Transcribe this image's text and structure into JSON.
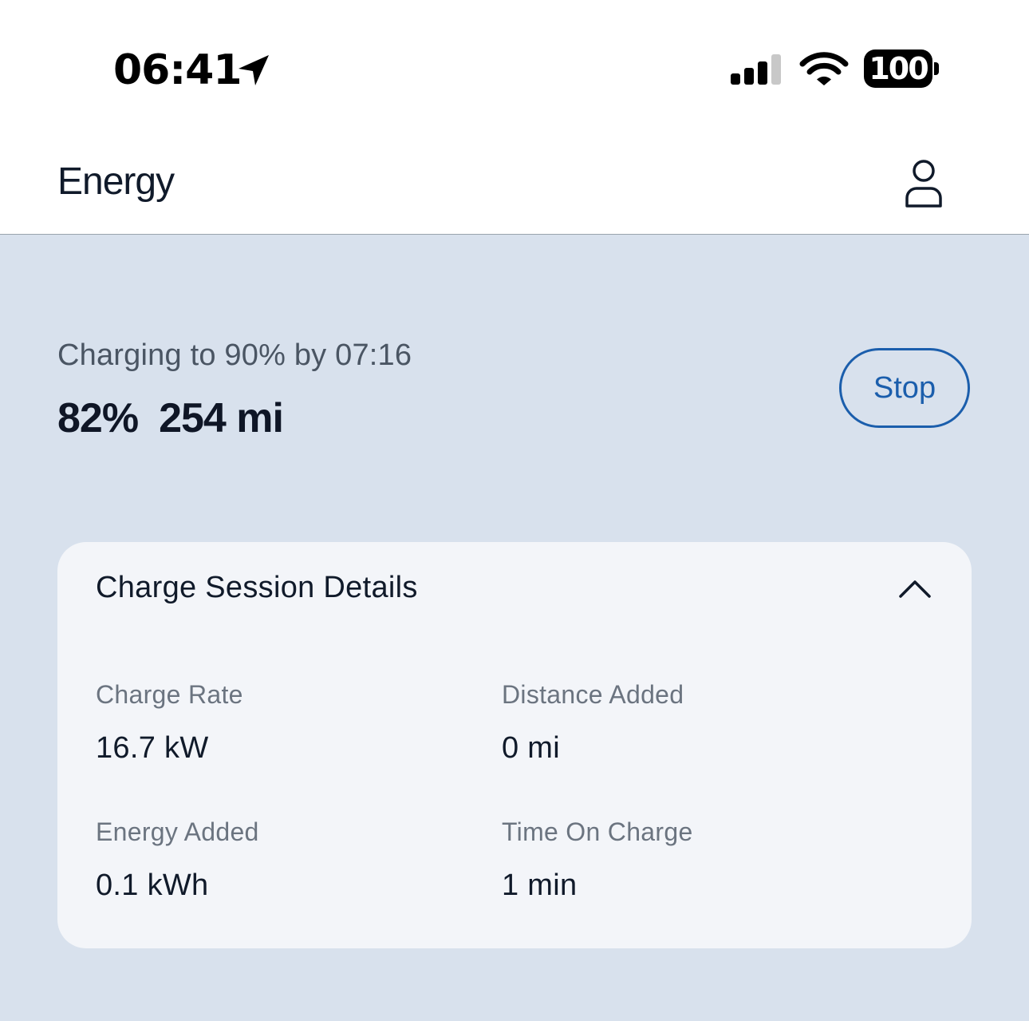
{
  "status_bar": {
    "time": "06:41",
    "battery_level": "100",
    "location_icon": "location-arrow-icon",
    "signal_icon": "cellular-signal-icon",
    "wifi_icon": "wifi-icon"
  },
  "header": {
    "title": "Energy",
    "profile_icon": "person-icon"
  },
  "charging": {
    "status": "Charging to 90% by 07:16",
    "percent": "82%",
    "range": "254 mi",
    "stop_label": "Stop"
  },
  "details": {
    "title": "Charge Session Details",
    "expanded": true,
    "toggle_icon": "chevron-up-icon",
    "items": [
      {
        "label": "Charge Rate",
        "value": "16.7 kW"
      },
      {
        "label": "Distance Added",
        "value": "0 mi"
      },
      {
        "label": "Energy Added",
        "value": "0.1 kWh"
      },
      {
        "label": "Time On Charge",
        "value": "1 min"
      }
    ]
  },
  "colors": {
    "background": "#d8e1ed",
    "card": "#f3f5f9",
    "accent": "#1b5eac",
    "text_primary": "#101a2a",
    "text_secondary": "#6b7480"
  }
}
